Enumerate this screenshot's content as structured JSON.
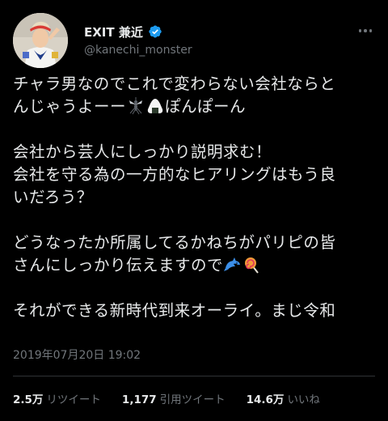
{
  "user": {
    "display_name": "EXIT 兼近",
    "handle": "@kanechi_monster",
    "verified": true
  },
  "icons": {
    "avatar": "avatar",
    "verified": "verified-badge-icon",
    "more": "more-options-icon",
    "emoji_1": "mosquito-emoji-icon",
    "emoji_2": "rice-ball-emoji-icon",
    "emoji_3": "dolphin-emoji-icon",
    "emoji_4": "lollipop-emoji-icon"
  },
  "tweet": {
    "p1_line1": "チャラ男なのでこれで変わらない会社ならと",
    "p1_line2_a": "んじゃうよーー",
    "p1_line2_b": "ぽんぽーん",
    "p2_line1": "会社から芸人にしっかり説明求む！",
    "p2_line2": "会社を守る為の一方的なヒアリングはもう良",
    "p2_line3": "いだろう？",
    "p3_line1": "どうなったか所属してるかねちがパリピの皆",
    "p3_line2": "さんにしっかり伝えますので",
    "p4_line1": "それができる新時代到来オーライ。まじ令和"
  },
  "timestamp": "2019年07月20日 19:02",
  "stats": {
    "retweets_count": "2.5万",
    "retweets_label": "リツイート",
    "quotes_count": "1,177",
    "quotes_label": "引用ツイート",
    "likes_count": "14.6万",
    "likes_label": "いいね"
  },
  "colors": {
    "background": "#000000",
    "text": "#e7e9ea",
    "secondary": "#71767b",
    "verified": "#1d9bf0",
    "divider": "#2f3336"
  }
}
